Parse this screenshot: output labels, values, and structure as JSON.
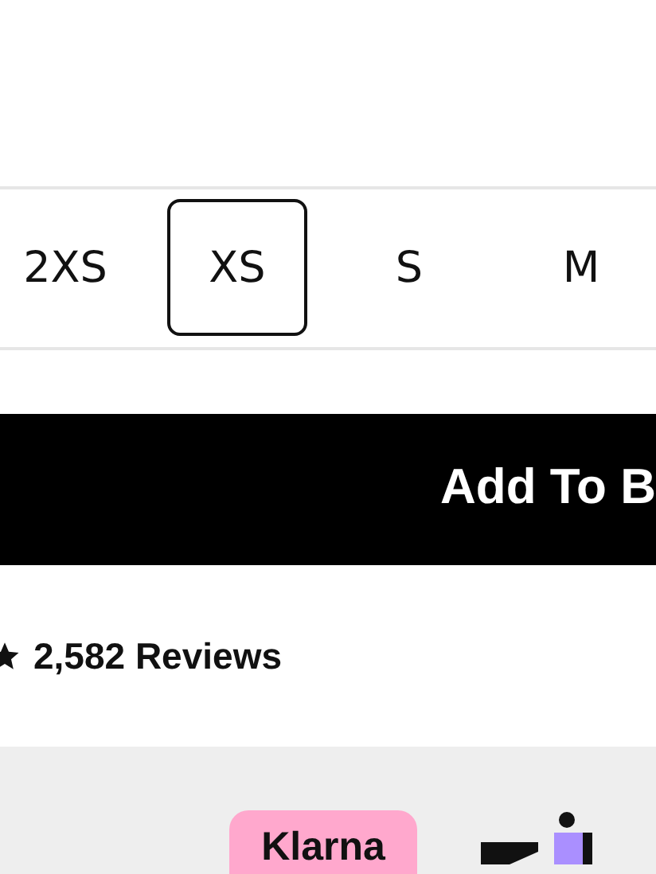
{
  "sizes": [
    {
      "label": "2XS",
      "selected": false
    },
    {
      "label": "XS",
      "selected": true
    },
    {
      "label": "S",
      "selected": false
    },
    {
      "label": "M",
      "selected": false
    }
  ],
  "add_button": {
    "label": "Add To B"
  },
  "reviews": {
    "label": "2,582 Reviews"
  },
  "payment": {
    "klarna": "Klarna"
  }
}
